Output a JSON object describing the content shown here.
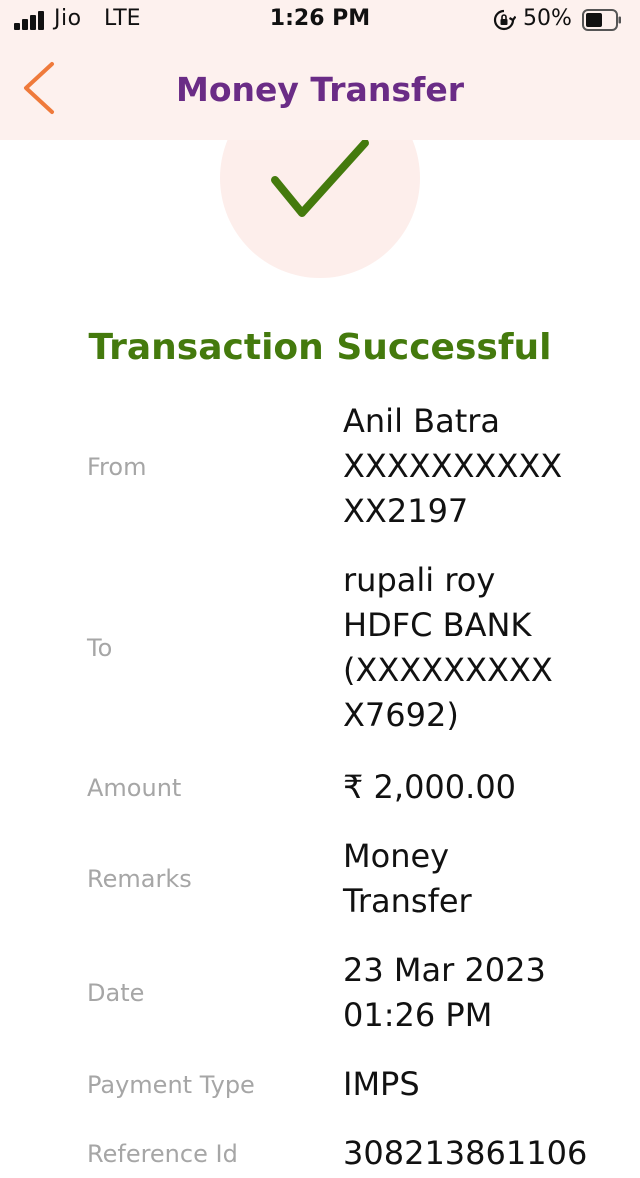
{
  "status_bar": {
    "carrier": "Jio",
    "network": "LTE",
    "time": "1:26 PM",
    "battery_percent": "50%"
  },
  "header": {
    "title": "Money Transfer",
    "back_icon": "chevron-left-icon",
    "background": "#fdf1ee",
    "title_color": "#6a2c86",
    "back_color": "#ef7a3b"
  },
  "status": {
    "icon": "checkmark-icon",
    "message": "Transaction Successful",
    "color": "#447a0d",
    "circle_color": "#fdeeeb"
  },
  "details": [
    {
      "label": "From",
      "lines": [
        "Anil Batra",
        "XXXXXXXXXX",
        "XX2197"
      ]
    },
    {
      "label": "To",
      "lines": [
        "rupali roy",
        "HDFC BANK",
        "(XXXXXXXXX",
        "X7692)"
      ]
    },
    {
      "label": "Amount",
      "lines": [
        "₹ 2,000.00"
      ]
    },
    {
      "label": "Remarks",
      "lines": [
        "Money",
        "Transfer"
      ]
    },
    {
      "label": "Date",
      "lines": [
        "23 Mar 2023",
        "01:26 PM"
      ]
    },
    {
      "label": "Payment Type",
      "lines": [
        "IMPS"
      ]
    },
    {
      "label": "Reference Id",
      "lines": [
        "308213861106"
      ]
    }
  ]
}
